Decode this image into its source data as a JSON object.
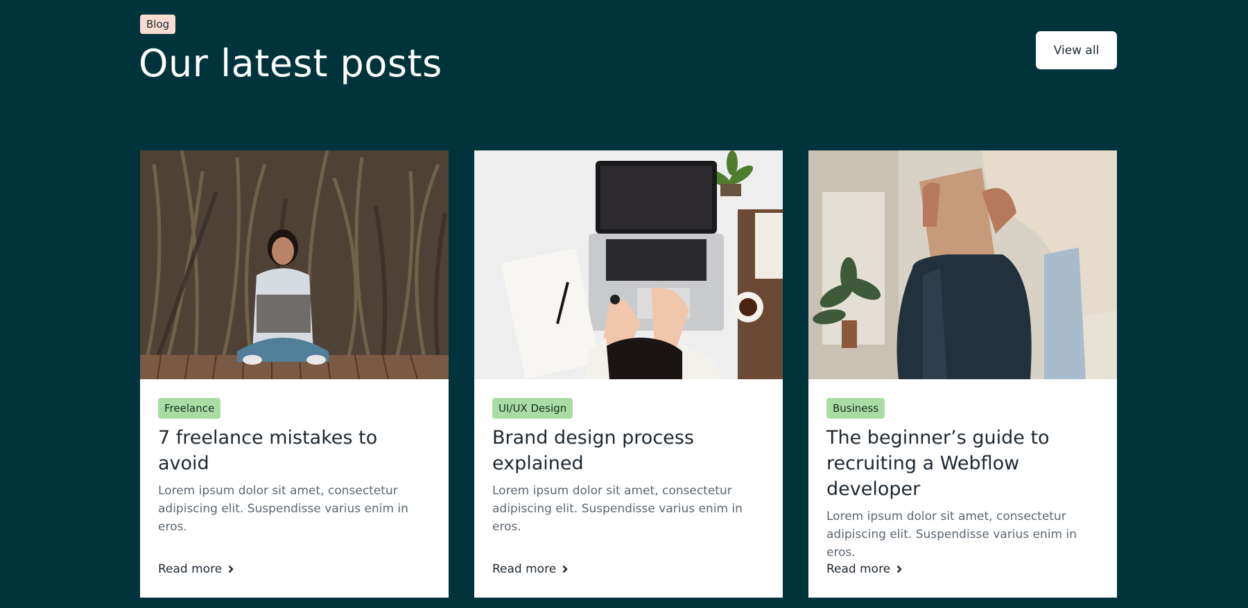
{
  "section": {
    "tag": "Blog",
    "title": "Our latest posts",
    "view_all_label": "View all"
  },
  "posts": [
    {
      "category": "Freelance",
      "title": "7 freelance mistakes to avoid",
      "excerpt": "Lorem ipsum dolor sit amet, consectetur adipiscing elit. Suspendisse varius enim in eros.",
      "read_more": "Read more"
    },
    {
      "category": "UI/UX Design",
      "title": "Brand design process explained",
      "excerpt": "Lorem ipsum dolor sit amet, consectetur adipiscing elit. Suspendisse varius enim in eros.",
      "read_more": "Read more"
    },
    {
      "category": "Business",
      "title": "The beginner’s guide to recruiting a Webflow developer",
      "excerpt": "Lorem ipsum dolor sit amet, consectetur adipiscing elit. Suspendisse varius enim in eros.",
      "read_more": "Read more"
    }
  ],
  "colors": {
    "background": "#00333b",
    "blog_tag": "#fadbd0",
    "category_tag": "#a9dca3",
    "card": "#ffffff"
  },
  "icons": {
    "read_more": "chevron-right-icon"
  }
}
